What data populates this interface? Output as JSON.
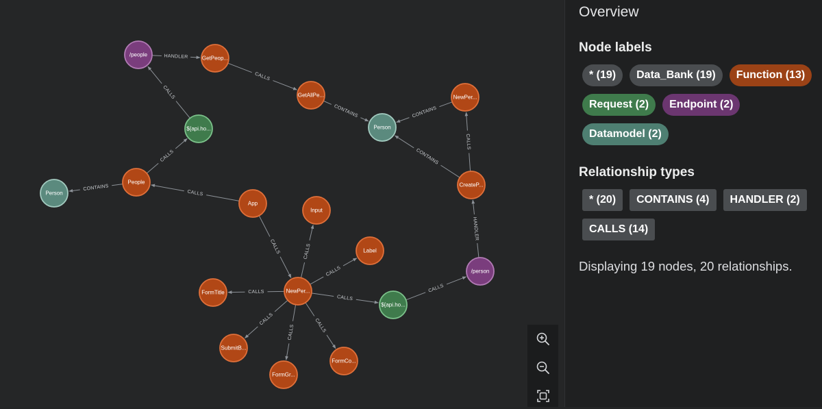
{
  "graph": {
    "nodes": [
      {
        "id": "people_ep",
        "label": "/people",
        "kind": "endpoint"
      },
      {
        "id": "getpeople",
        "label": "GetPeop...",
        "kind": "function"
      },
      {
        "id": "getallpe",
        "label": "GetAllPe...",
        "kind": "function"
      },
      {
        "id": "person_top",
        "label": "Person",
        "kind": "datamodel"
      },
      {
        "id": "newper_top",
        "label": "NewPer...",
        "kind": "function"
      },
      {
        "id": "api_top",
        "label": "${api.ho...",
        "kind": "request"
      },
      {
        "id": "people_fn",
        "label": "People",
        "kind": "function"
      },
      {
        "id": "person_left",
        "label": "Person",
        "kind": "datamodel"
      },
      {
        "id": "createp",
        "label": "CreateP...",
        "kind": "function"
      },
      {
        "id": "app",
        "label": "App",
        "kind": "function"
      },
      {
        "id": "input",
        "label": "Input",
        "kind": "function"
      },
      {
        "id": "label",
        "label": "Label",
        "kind": "function"
      },
      {
        "id": "person_ep",
        "label": "/person",
        "kind": "endpoint"
      },
      {
        "id": "newper_mid",
        "label": "NewPer...",
        "kind": "function"
      },
      {
        "id": "formtitle",
        "label": "FormTitle",
        "kind": "function"
      },
      {
        "id": "api_mid",
        "label": "${api.ho...",
        "kind": "request"
      },
      {
        "id": "submitb",
        "label": "SubmitB...",
        "kind": "function"
      },
      {
        "id": "formco",
        "label": "FormCo...",
        "kind": "function"
      },
      {
        "id": "formgr",
        "label": "FormGr...",
        "kind": "function"
      }
    ],
    "edges": [
      {
        "from": "people_ep",
        "to": "getpeople",
        "label": "HANDLER"
      },
      {
        "from": "getpeople",
        "to": "getallpe",
        "label": "CALLS"
      },
      {
        "from": "getallpe",
        "to": "person_top",
        "label": "CONTAINS"
      },
      {
        "from": "newper_top",
        "to": "person_top",
        "label": "CONTAINS"
      },
      {
        "from": "createp",
        "to": "person_top",
        "label": "CONTAINS"
      },
      {
        "from": "createp",
        "to": "newper_top",
        "label": "CALLS"
      },
      {
        "from": "api_top",
        "to": "people_ep",
        "label": "CALLS"
      },
      {
        "from": "people_fn",
        "to": "api_top",
        "label": "CALLS"
      },
      {
        "from": "people_fn",
        "to": "person_left",
        "label": "CONTAINS"
      },
      {
        "from": "app",
        "to": "people_fn",
        "label": "CALLS"
      },
      {
        "from": "app",
        "to": "newper_mid",
        "label": "CALLS"
      },
      {
        "from": "newper_mid",
        "to": "input",
        "label": "CALLS"
      },
      {
        "from": "newper_mid",
        "to": "label",
        "label": "CALLS"
      },
      {
        "from": "newper_mid",
        "to": "formtitle",
        "label": "CALLS"
      },
      {
        "from": "newper_mid",
        "to": "api_mid",
        "label": "CALLS"
      },
      {
        "from": "newper_mid",
        "to": "submitb",
        "label": "CALLS"
      },
      {
        "from": "newper_mid",
        "to": "formgr",
        "label": "CALLS"
      },
      {
        "from": "newper_mid",
        "to": "formco",
        "label": "CALLS"
      },
      {
        "from": "api_mid",
        "to": "person_ep",
        "label": "CALLS"
      },
      {
        "from": "person_ep",
        "to": "createp",
        "label": "HANDLER"
      }
    ],
    "colors": {
      "function": {
        "fill": "#b14716",
        "stroke": "#e0703a"
      },
      "endpoint": {
        "fill": "#7a3d7d",
        "stroke": "#b27bb5"
      },
      "request": {
        "fill": "#3f7b4c",
        "stroke": "#7cc28b"
      },
      "datamodel": {
        "fill": "#5b8a7e",
        "stroke": "#a3cbc0"
      }
    }
  },
  "zoom_controls": {
    "zoom_in_icon": "zoom-in-icon",
    "zoom_out_icon": "zoom-out-icon",
    "fit_icon": "fit-to-screen-icon"
  },
  "sidebar": {
    "title": "Overview",
    "node_labels_title": "Node labels",
    "node_labels": [
      {
        "text": "* (19)",
        "color": "#4a4d50"
      },
      {
        "text": "Data_Bank (19)",
        "color": "#4a4d50"
      },
      {
        "text": "Function (13)",
        "color": "#9b4216"
      },
      {
        "text": "Request (2)",
        "color": "#3f7b4c"
      },
      {
        "text": "Endpoint (2)",
        "color": "#6b3670"
      },
      {
        "text": "Datamodel (2)",
        "color": "#4e7f72"
      }
    ],
    "relationship_types_title": "Relationship types",
    "relationship_types": [
      {
        "text": "* (20)",
        "color": "#4a4d50"
      },
      {
        "text": "CONTAINS (4)",
        "color": "#4a4d50"
      },
      {
        "text": "HANDLER (2)",
        "color": "#4a4d50"
      },
      {
        "text": "CALLS (14)",
        "color": "#4a4d50"
      }
    ],
    "summary": "Displaying 19 nodes, 20 relationships."
  }
}
